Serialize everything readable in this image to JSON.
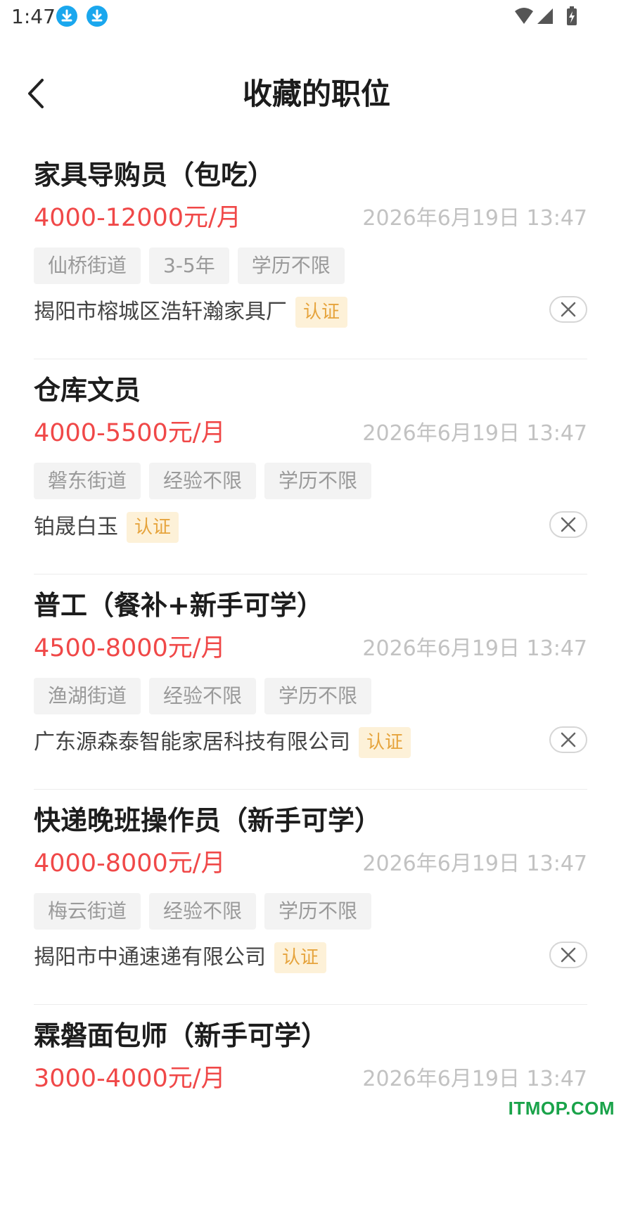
{
  "status_bar": {
    "time": "1:47"
  },
  "header": {
    "title": "收藏的职位"
  },
  "jobs": [
    {
      "title": "家具导购员（包吃）",
      "salary": "4000-12000元/月",
      "time": "2026年6月19日 13:47",
      "tags": [
        "仙桥街道",
        "3-5年",
        "学历不限"
      ],
      "company": "揭阳市榕城区浩轩瀚家具厂",
      "badge": "认证"
    },
    {
      "title": "仓库文员",
      "salary": "4000-5500元/月",
      "time": "2026年6月19日 13:47",
      "tags": [
        "磐东街道",
        "经验不限",
        "学历不限"
      ],
      "company": "铂晟白玉",
      "badge": "认证"
    },
    {
      "title": "普工（餐补+新手可学）",
      "salary": "4500-8000元/月",
      "time": "2026年6月19日 13:47",
      "tags": [
        "渔湖街道",
        "经验不限",
        "学历不限"
      ],
      "company": "广东源森泰智能家居科技有限公司",
      "badge": "认证"
    },
    {
      "title": "快递晚班操作员（新手可学）",
      "salary": "4000-8000元/月",
      "time": "2026年6月19日 13:47",
      "tags": [
        "梅云街道",
        "经验不限",
        "学历不限"
      ],
      "company": "揭阳市中通速递有限公司",
      "badge": "认证"
    },
    {
      "title": "霖磐面包师（新手可学）",
      "salary": "3000-4000元/月",
      "time": "2026年6月19日 13:47",
      "tags": [],
      "company": "",
      "badge": ""
    }
  ],
  "watermark": "ITMOP.COM",
  "colors": {
    "salary": "#f04848",
    "badge_bg": "#fdf1d8",
    "badge_text": "#e6a43d",
    "download_icon": "#1aa7ee"
  }
}
